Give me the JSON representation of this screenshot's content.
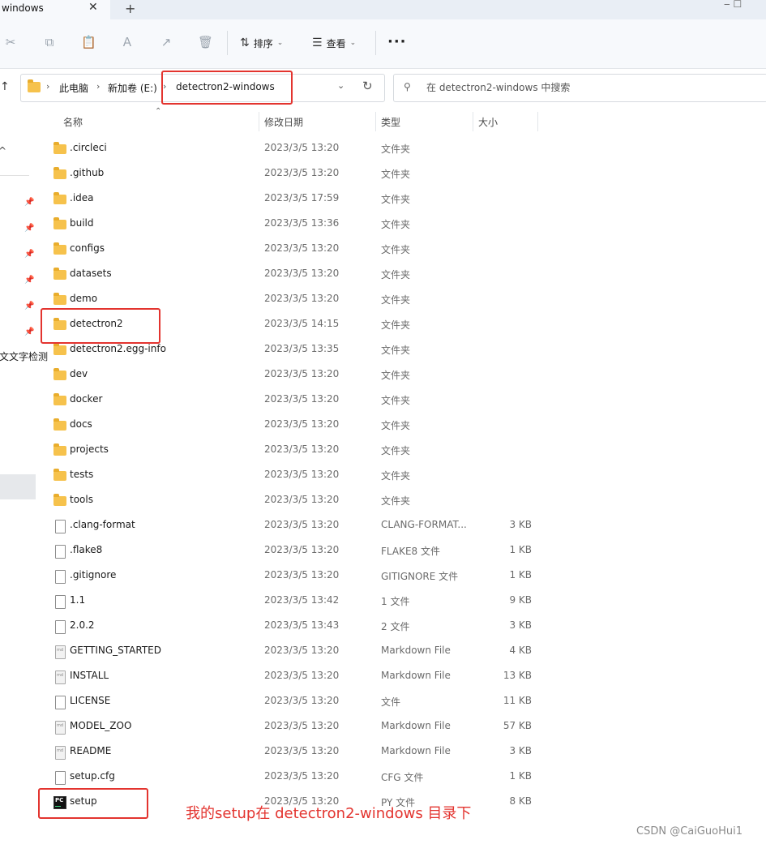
{
  "tab": {
    "title": "windows",
    "close": "✕",
    "new": "+"
  },
  "window_controls": "‒   ☐",
  "toolbar": {
    "sort_label": "排序",
    "view_label": "查看",
    "more_label": "···"
  },
  "address": {
    "crumbs": [
      "此电脑",
      "新加卷 (E:)",
      "detectron2-windows"
    ]
  },
  "search": {
    "placeholder": "在 detectron2-windows 中搜索"
  },
  "left_nav": {
    "clipped_item": "文文字检测"
  },
  "columns": {
    "name": "名称",
    "date": "修改日期",
    "type": "类型",
    "size": "大小"
  },
  "files": [
    {
      "name": ".circleci",
      "date": "2023/3/5 13:20",
      "type": "文件夹",
      "size": "",
      "icon": "folder"
    },
    {
      "name": ".github",
      "date": "2023/3/5 13:20",
      "type": "文件夹",
      "size": "",
      "icon": "folder"
    },
    {
      "name": ".idea",
      "date": "2023/3/5 17:59",
      "type": "文件夹",
      "size": "",
      "icon": "folder"
    },
    {
      "name": "build",
      "date": "2023/3/5 13:36",
      "type": "文件夹",
      "size": "",
      "icon": "folder"
    },
    {
      "name": "configs",
      "date": "2023/3/5 13:20",
      "type": "文件夹",
      "size": "",
      "icon": "folder"
    },
    {
      "name": "datasets",
      "date": "2023/3/5 13:20",
      "type": "文件夹",
      "size": "",
      "icon": "folder"
    },
    {
      "name": "demo",
      "date": "2023/3/5 13:20",
      "type": "文件夹",
      "size": "",
      "icon": "folder"
    },
    {
      "name": "detectron2",
      "date": "2023/3/5 14:15",
      "type": "文件夹",
      "size": "",
      "icon": "folder"
    },
    {
      "name": "detectron2.egg-info",
      "date": "2023/3/5 13:35",
      "type": "文件夹",
      "size": "",
      "icon": "folder"
    },
    {
      "name": "dev",
      "date": "2023/3/5 13:20",
      "type": "文件夹",
      "size": "",
      "icon": "folder"
    },
    {
      "name": "docker",
      "date": "2023/3/5 13:20",
      "type": "文件夹",
      "size": "",
      "icon": "folder"
    },
    {
      "name": "docs",
      "date": "2023/3/5 13:20",
      "type": "文件夹",
      "size": "",
      "icon": "folder"
    },
    {
      "name": "projects",
      "date": "2023/3/5 13:20",
      "type": "文件夹",
      "size": "",
      "icon": "folder"
    },
    {
      "name": "tests",
      "date": "2023/3/5 13:20",
      "type": "文件夹",
      "size": "",
      "icon": "folder"
    },
    {
      "name": "tools",
      "date": "2023/3/5 13:20",
      "type": "文件夹",
      "size": "",
      "icon": "folder"
    },
    {
      "name": ".clang-format",
      "date": "2023/3/5 13:20",
      "type": "CLANG-FORMAT...",
      "size": "3 KB",
      "icon": "file"
    },
    {
      "name": ".flake8",
      "date": "2023/3/5 13:20",
      "type": "FLAKE8 文件",
      "size": "1 KB",
      "icon": "file"
    },
    {
      "name": ".gitignore",
      "date": "2023/3/5 13:20",
      "type": "GITIGNORE 文件",
      "size": "1 KB",
      "icon": "file"
    },
    {
      "name": "1.1",
      "date": "2023/3/5 13:42",
      "type": "1 文件",
      "size": "9 KB",
      "icon": "file"
    },
    {
      "name": "2.0.2",
      "date": "2023/3/5 13:43",
      "type": "2 文件",
      "size": "3 KB",
      "icon": "file"
    },
    {
      "name": "GETTING_STARTED",
      "date": "2023/3/5 13:20",
      "type": "Markdown File",
      "size": "4 KB",
      "icon": "markdown"
    },
    {
      "name": "INSTALL",
      "date": "2023/3/5 13:20",
      "type": "Markdown File",
      "size": "13 KB",
      "icon": "markdown"
    },
    {
      "name": "LICENSE",
      "date": "2023/3/5 13:20",
      "type": "文件",
      "size": "11 KB",
      "icon": "file"
    },
    {
      "name": "MODEL_ZOO",
      "date": "2023/3/5 13:20",
      "type": "Markdown File",
      "size": "57 KB",
      "icon": "markdown"
    },
    {
      "name": "README",
      "date": "2023/3/5 13:20",
      "type": "Markdown File",
      "size": "3 KB",
      "icon": "markdown"
    },
    {
      "name": "setup.cfg",
      "date": "2023/3/5 13:20",
      "type": "CFG 文件",
      "size": "1 KB",
      "icon": "file"
    },
    {
      "name": "setup",
      "date": "2023/3/5 13:20",
      "type": "PY 文件",
      "size": "8 KB",
      "icon": "python"
    }
  ],
  "annotation": "我的setup在 detectron2-windows   目录下",
  "watermark": "CSDN @CaiGuoHui1",
  "colors": {
    "highlight": "#e3342f",
    "folder": "#f6c24c",
    "toolbar_bg": "#f7f9fc"
  }
}
